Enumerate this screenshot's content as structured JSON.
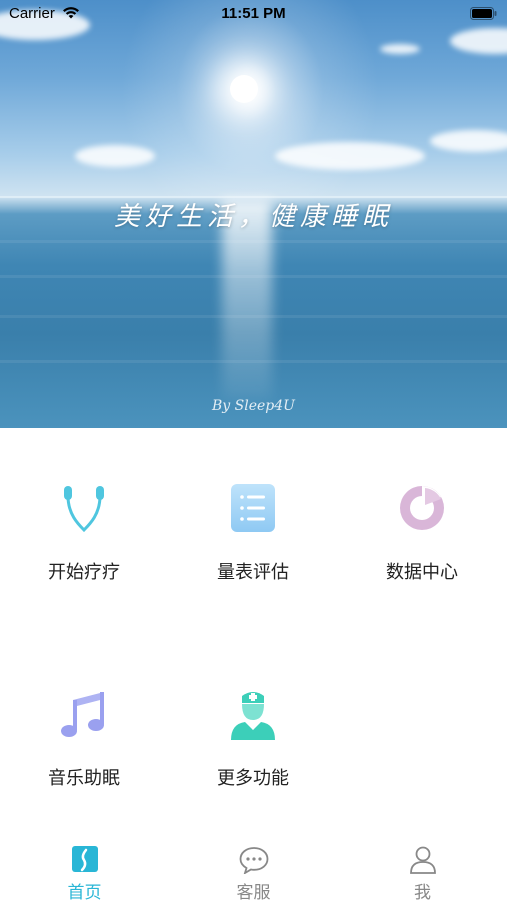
{
  "status_bar": {
    "carrier": "Carrier",
    "time": "11:51 PM"
  },
  "hero": {
    "slogan": "美好生活，健康睡眠",
    "signature": "By Sleep4U"
  },
  "grid": {
    "items": [
      {
        "label": "开始疗疗",
        "icon": "earphones-icon"
      },
      {
        "label": "量表评估",
        "icon": "list-document-icon"
      },
      {
        "label": "数据中心",
        "icon": "pie-chart-icon"
      },
      {
        "label": "音乐助眠",
        "icon": "music-note-icon"
      },
      {
        "label": "更多功能",
        "icon": "doctor-icon"
      }
    ]
  },
  "tab_bar": {
    "tabs": [
      {
        "label": "首页",
        "icon": "home-icon",
        "active": true
      },
      {
        "label": "客服",
        "icon": "chat-bubble-icon",
        "active": false
      },
      {
        "label": "我",
        "icon": "person-icon",
        "active": false
      }
    ]
  },
  "colors": {
    "accent": "#29b6d6",
    "text": "#222222",
    "inactive": "#888888"
  }
}
